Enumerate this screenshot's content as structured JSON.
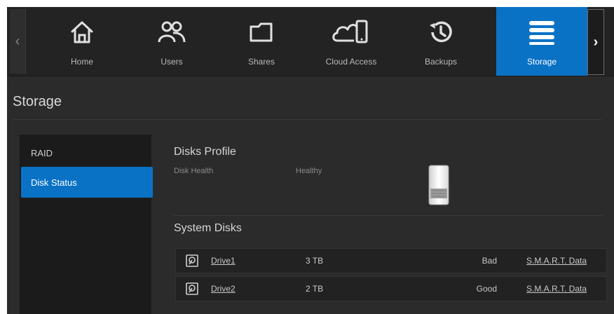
{
  "nav": {
    "items": [
      {
        "label": "Home",
        "icon": "home-icon"
      },
      {
        "label": "Users",
        "icon": "users-icon"
      },
      {
        "label": "Shares",
        "icon": "folder-icon"
      },
      {
        "label": "Cloud Access",
        "icon": "cloud-device-icon"
      },
      {
        "label": "Backups",
        "icon": "history-icon"
      },
      {
        "label": "Storage",
        "icon": "storage-icon",
        "active": true
      }
    ],
    "prev_arrow": "‹",
    "next_arrow": "›"
  },
  "page": {
    "title": "Storage"
  },
  "sidebar": {
    "items": [
      {
        "label": "RAID",
        "selected": false
      },
      {
        "label": "Disk Status",
        "selected": true
      }
    ]
  },
  "disks_profile": {
    "title": "Disks Profile",
    "health_label": "Disk Health",
    "health_value": "Healthy"
  },
  "system_disks": {
    "title": "System Disks",
    "rows": [
      {
        "name": "Drive1",
        "size": "3 TB",
        "status": "Bad",
        "smart_link": "S.M.A.R.T. Data"
      },
      {
        "name": "Drive2",
        "size": "2 TB",
        "status": "Good",
        "smart_link": "S.M.A.R.T. Data"
      }
    ]
  },
  "colors": {
    "accent": "#0a72c5",
    "background": "#2b2b2b",
    "nav_background": "#232323"
  }
}
